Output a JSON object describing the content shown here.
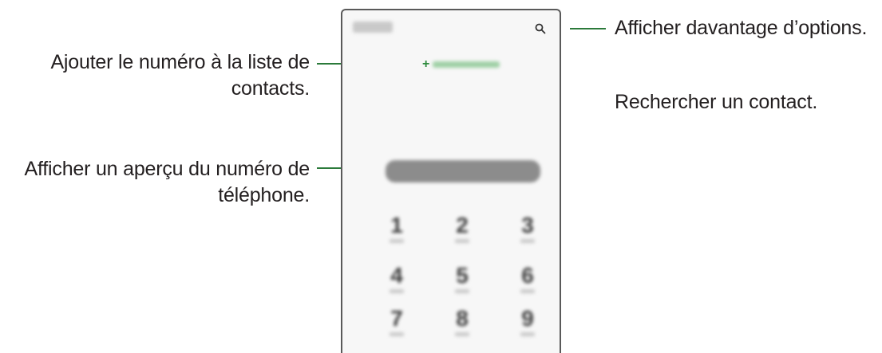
{
  "callouts": {
    "add_contact": "Ajouter le numéro à la liste de contacts.",
    "preview_number": "Afficher un aperçu du numéro de téléphone.",
    "more_options": "Afficher davantage d’options.",
    "search_contact": "Rechercher un contact."
  },
  "keypad": {
    "keys": [
      {
        "digit": "1"
      },
      {
        "digit": "2"
      },
      {
        "digit": "3"
      },
      {
        "digit": "4"
      },
      {
        "digit": "5"
      },
      {
        "digit": "6"
      },
      {
        "digit": "7"
      },
      {
        "digit": "8"
      },
      {
        "digit": "9"
      }
    ]
  },
  "icons": {
    "search": "search-icon",
    "more": "more-options-icon",
    "add": "plus-icon"
  },
  "colors": {
    "leader_line": "#2b7a3a",
    "accent_green": "#2e8b3e"
  }
}
